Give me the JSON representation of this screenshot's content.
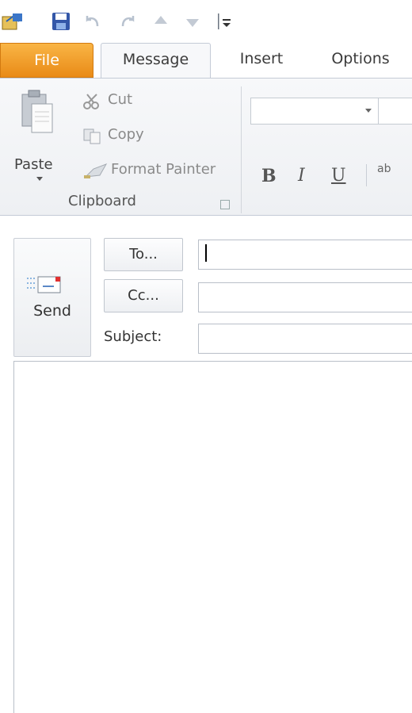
{
  "quick_access": {
    "icons": [
      "outlook-icon",
      "save-icon",
      "undo-icon",
      "redo-icon",
      "up-arrow-icon",
      "down-arrow-icon",
      "customize-icon"
    ]
  },
  "tabs": {
    "file": "File",
    "message": "Message",
    "insert": "Insert",
    "options": "Options"
  },
  "ribbon": {
    "clipboard": {
      "paste": "Paste",
      "cut": "Cut",
      "copy": "Copy",
      "format_painter": "Format Painter",
      "group_label": "Clipboard"
    },
    "basic_text": {
      "bold": "B",
      "italic": "I",
      "underline": "U",
      "strike": "ab"
    }
  },
  "compose": {
    "send": "Send",
    "to_button": "To...",
    "cc_button": "Cc...",
    "subject_label": "Subject:",
    "to_value": "",
    "cc_value": "",
    "subject_value": ""
  },
  "colors": {
    "file_tab": "#e98b17",
    "border": "#c4cbd6"
  }
}
